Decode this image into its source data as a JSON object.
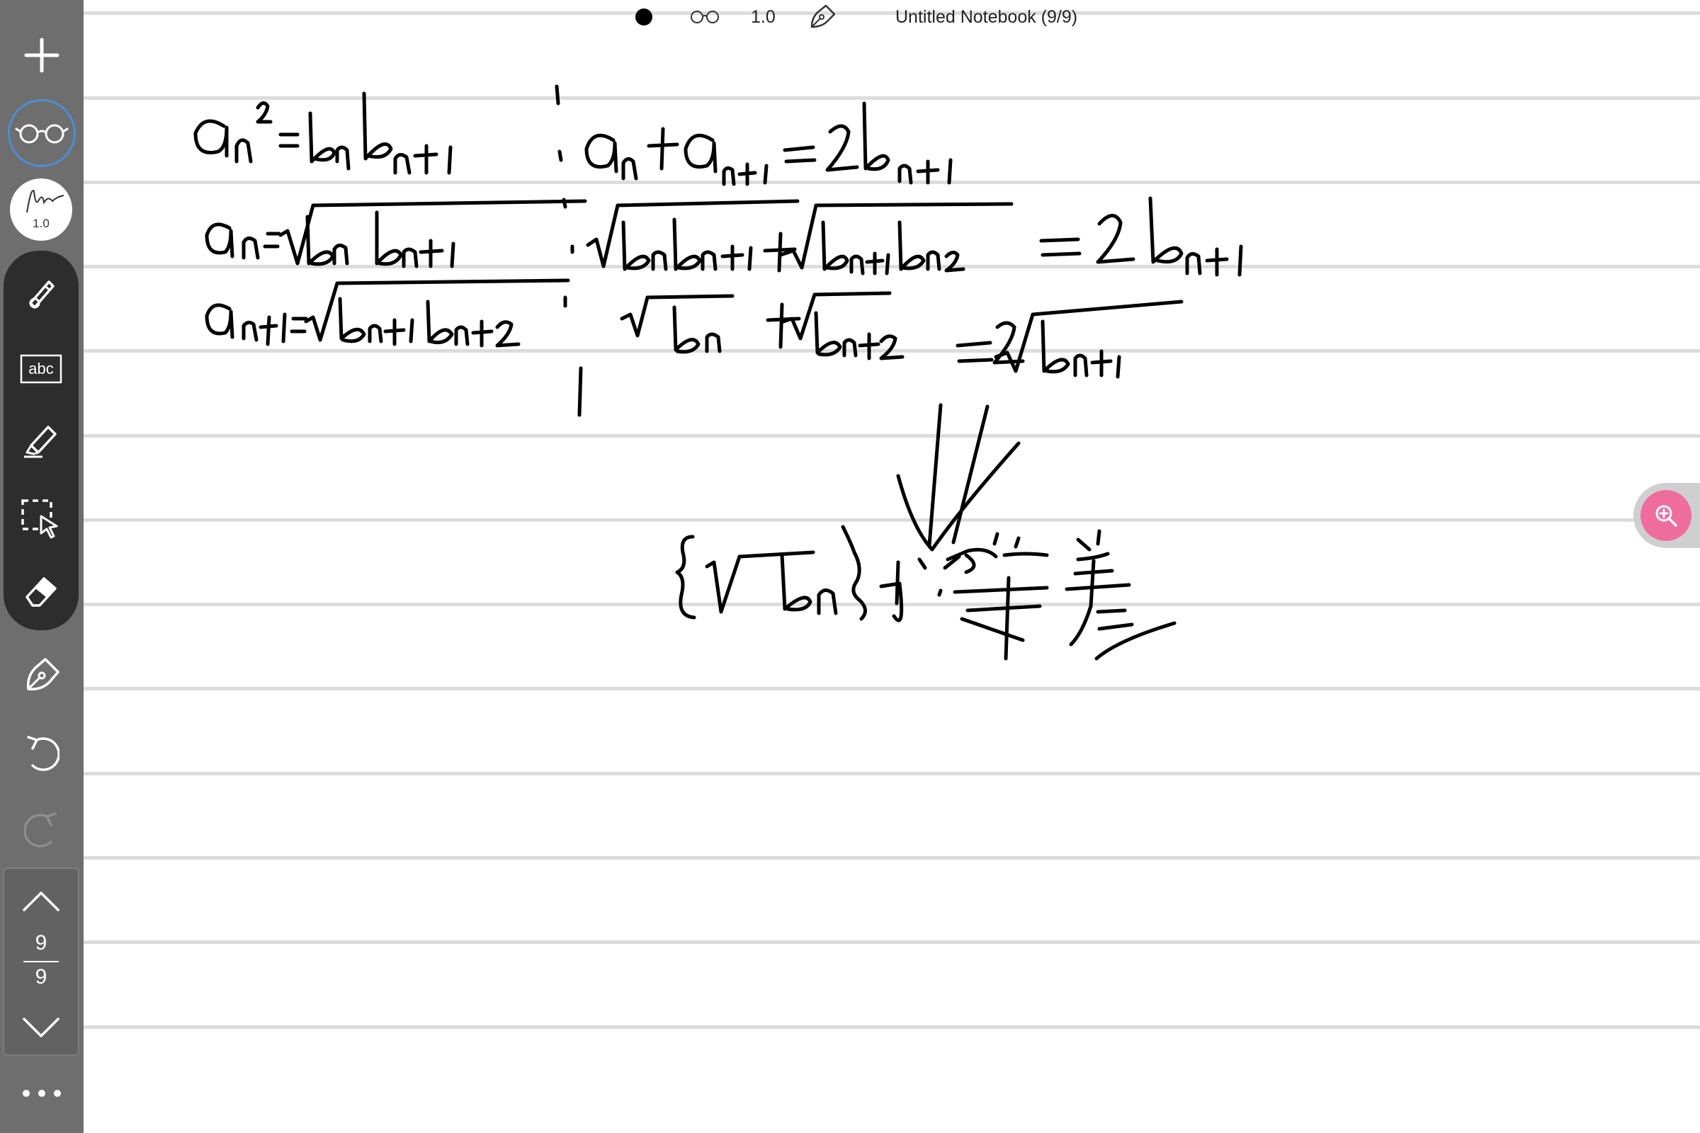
{
  "app": {
    "title": "Untitled Notebook (9/9)",
    "zoom": "1.0"
  },
  "sidebar": {
    "pen_width": "1.0",
    "page_current": "9",
    "page_total": "9"
  },
  "tools": [
    {
      "name": "pen",
      "icon": "pen-icon"
    },
    {
      "name": "text",
      "icon": "text-box-icon",
      "label": "abc"
    },
    {
      "name": "highlighter",
      "icon": "highlighter-icon"
    },
    {
      "name": "lasso",
      "icon": "lasso-select-icon"
    },
    {
      "name": "eraser",
      "icon": "eraser-icon"
    }
  ],
  "colors": {
    "sidebar_bg": "#6e6e6e",
    "tool_panel_bg": "#2d2d2d",
    "accent_blue": "#4a8fd6",
    "zoom_fab": "#ef6d9c",
    "ink": "#000000",
    "rule_line": "#dcdcdc"
  }
}
